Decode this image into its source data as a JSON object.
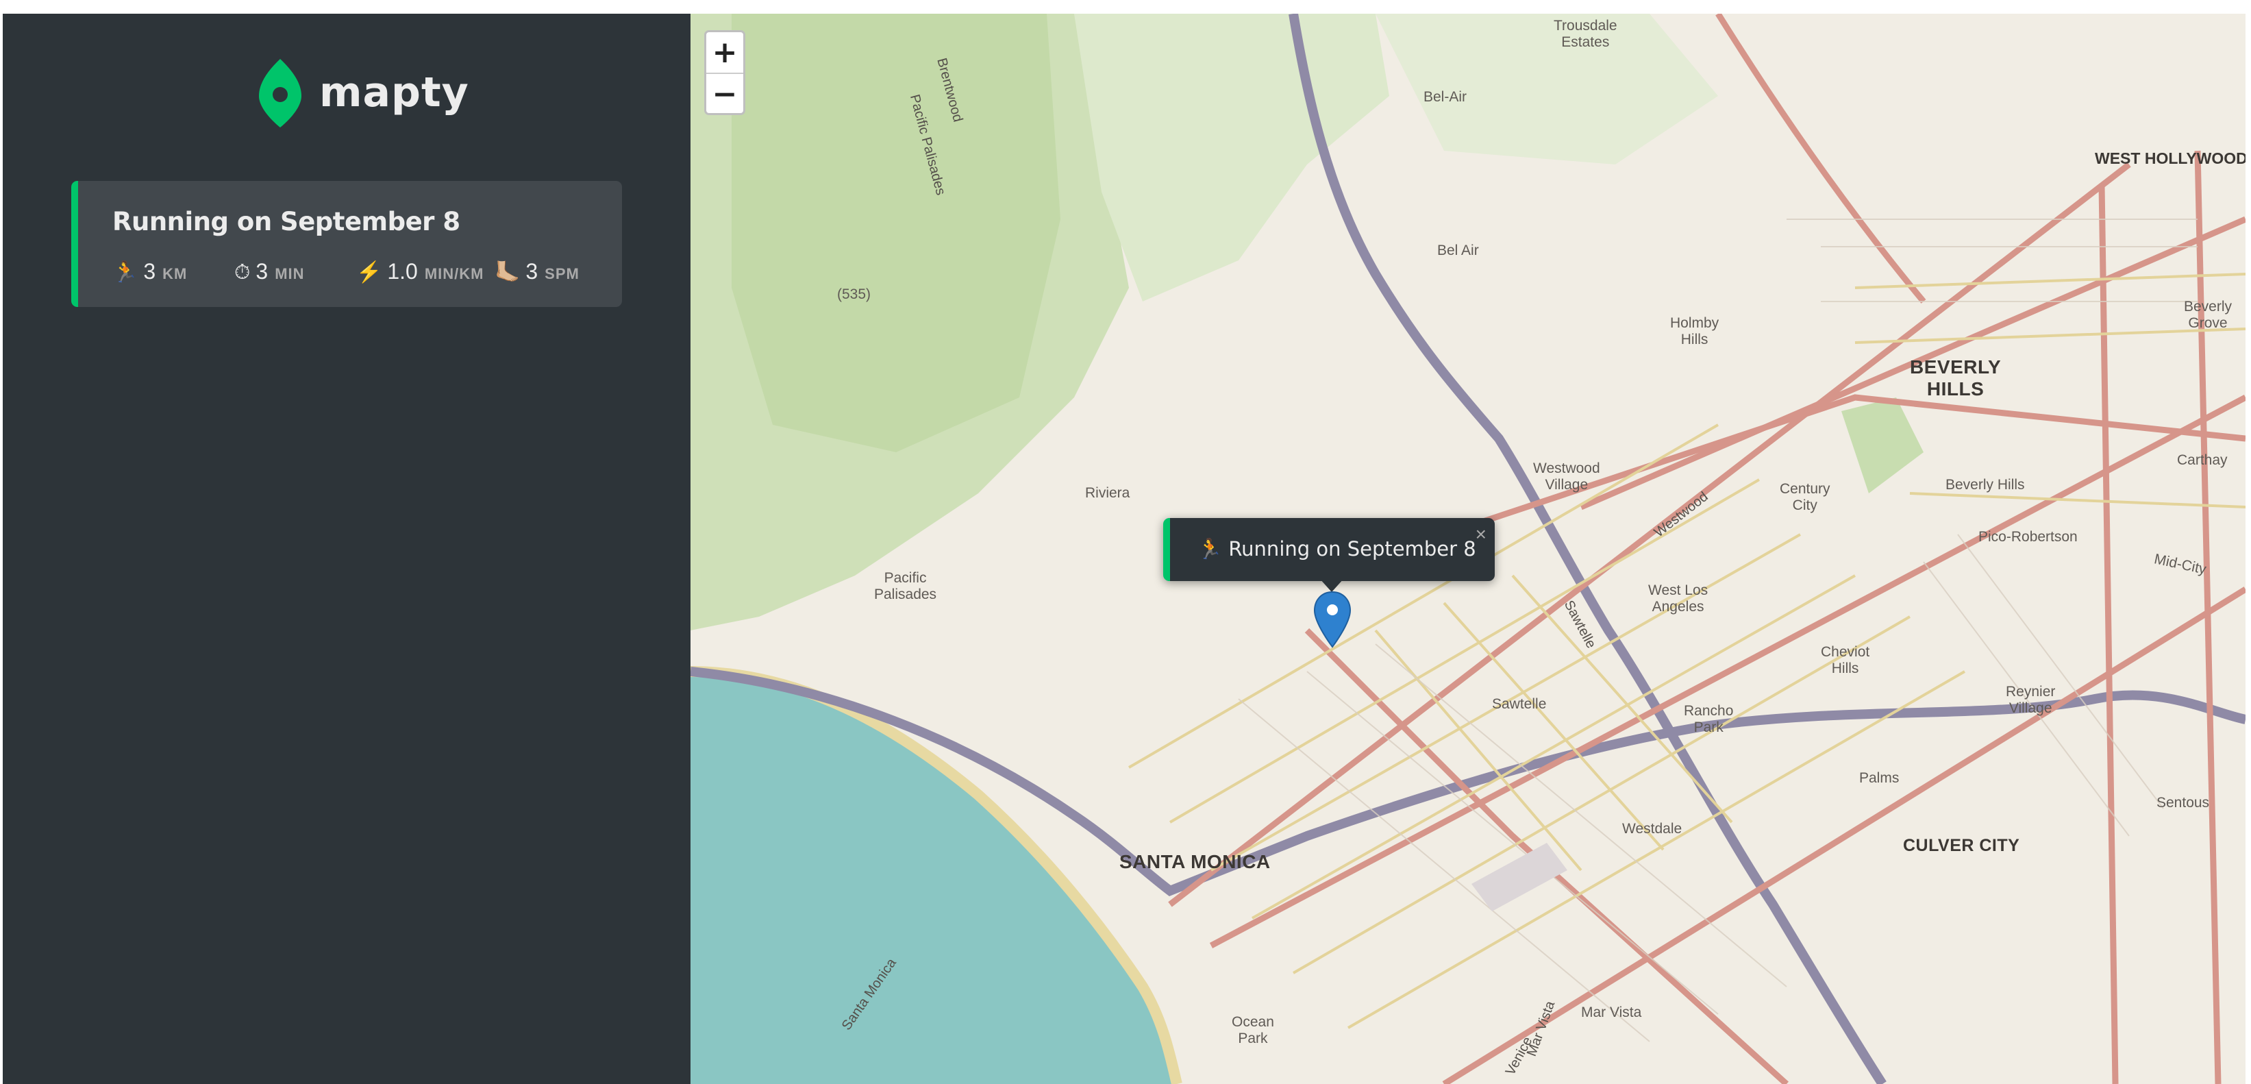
{
  "logo": {
    "text": "mapty",
    "icon": "map-pin-icon",
    "color": "#00c46a"
  },
  "workouts": [
    {
      "title": "Running on September 8",
      "type": "running",
      "details": [
        {
          "icon": "🏃",
          "value": "3",
          "unit": "km"
        },
        {
          "icon": "⏱",
          "value": "3",
          "unit": "min"
        },
        {
          "icon": "⚡️",
          "value": "1.0",
          "unit": "min/km"
        },
        {
          "icon": "🦶🏼",
          "value": "3",
          "unit": "spm"
        }
      ]
    }
  ],
  "map": {
    "zoom_in": "+",
    "zoom_out": "−",
    "popup": {
      "icon": "🏃",
      "text": "Running on September 8",
      "close": "×"
    },
    "labels": {
      "trousdale": "Trousdale\nEstates",
      "west_hollywood": "WEST HOLLYWOOD",
      "bel_air": "Bel-Air",
      "bel_air2": "Bel Air",
      "brentwood": "Brentwood",
      "pacific_palisades_road": "Pacific Palisades",
      "elev": "(535)",
      "holmby": "Holmby\nHills",
      "beverly_grove": "Beverly\nGrove",
      "beverly_hills": "BEVERLY\nHILLS",
      "westwood_village": "Westwood\nVillage",
      "westwood": "Westwood",
      "century_city": "Century\nCity",
      "beverly_hills_small": "Beverly Hills",
      "carthay": "Carthay",
      "riviera": "Riviera",
      "pico_robertson": "Pico-Robertson",
      "mid_city": "Mid-City",
      "pacific_palisades": "Pacific\nPalisades",
      "west_los_angeles": "West Los\nAngeles",
      "sawtelle_road": "Sawtelle",
      "cheviot_hills": "Cheviot\nHills",
      "reynier_village": "Reynier\nVillage",
      "sawtelle": "Sawtelle",
      "rancho_park": "Rancho\nPark",
      "palms": "Palms",
      "sentous": "Sentous",
      "santa_monica": "SANTA MONICA",
      "westdale": "Westdale",
      "culver_city": "CULVER CITY",
      "santa_monica_bay": "Santa Monica",
      "ocean_park": "Ocean\nPark",
      "mar_vista": "Mar Vista",
      "mar_vista_road": "Mar Vista",
      "venice": "Venice"
    }
  }
}
